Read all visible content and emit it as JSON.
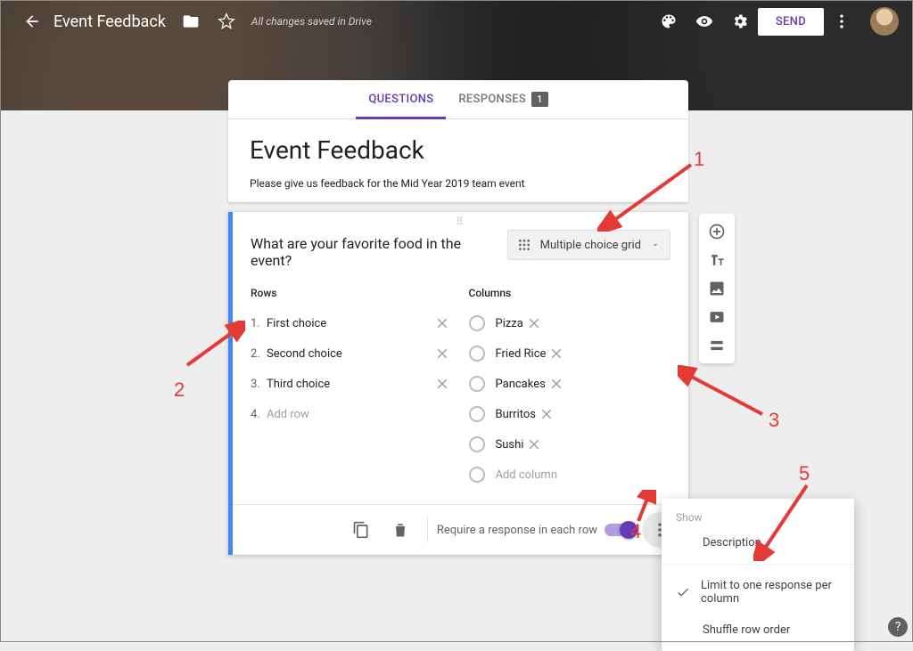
{
  "header": {
    "app_title": "Event Feedback",
    "save_note": "All changes saved in Drive",
    "send_label": "SEND"
  },
  "tabs": {
    "questions": "QUESTIONS",
    "responses": "RESPONSES",
    "responses_count": "1"
  },
  "form": {
    "title": "Event Feedback",
    "description": "Please give us feedback for the Mid Year 2019 team event"
  },
  "question": {
    "text": "What are your favorite food in the event?",
    "type_label": "Multiple choice grid",
    "rows_header": "Rows",
    "columns_header": "Columns",
    "rows": [
      {
        "n": "1.",
        "label": "First choice"
      },
      {
        "n": "2.",
        "label": "Second choice"
      },
      {
        "n": "3.",
        "label": "Third choice"
      }
    ],
    "add_row_n": "4.",
    "add_row_label": "Add row",
    "columns": [
      {
        "label": "Pizza"
      },
      {
        "label": "Fried Rice"
      },
      {
        "label": "Pancakes"
      },
      {
        "label": "Burritos"
      },
      {
        "label": "Sushi"
      }
    ],
    "add_column_label": "Add column",
    "require_label": "Require a response in each row"
  },
  "popover": {
    "show_label": "Show",
    "description": "Description",
    "limit": "Limit to one response per column",
    "shuffle": "Shuffle row order"
  },
  "annotations": {
    "n1": "1",
    "n2": "2",
    "n3": "3",
    "n4": "4",
    "n5": "5"
  },
  "help": "?"
}
